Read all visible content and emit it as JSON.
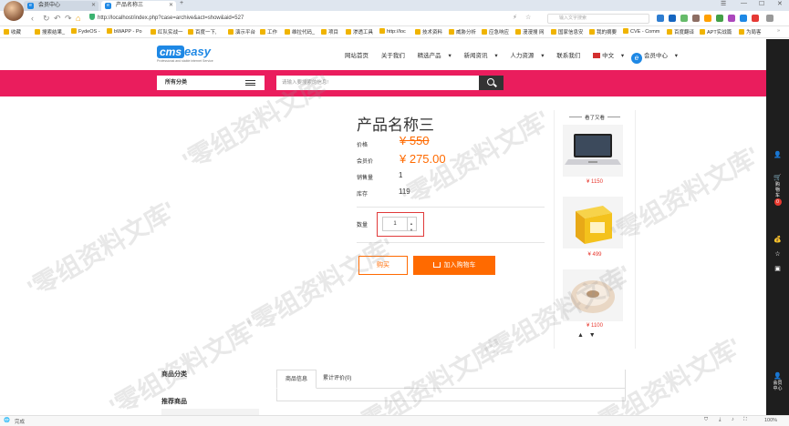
{
  "browser": {
    "tabs": [
      {
        "title": "会员中心",
        "active": false
      },
      {
        "title": "产品名称三",
        "active": true
      }
    ],
    "url": "http://localhost/index.php?case=archive&act=show&aid=527",
    "search_placeholder": "输入文字搜索",
    "bookmarks": [
      "收藏",
      "搜索结果_",
      "FydeOS -",
      "bWAPP - Po",
      "红队实战一",
      "百度一下,",
      "演示平台",
      "工作",
      "维拉代码_",
      "项目",
      "渗透工具",
      "http://loc",
      "技术资料",
      "威胁分析",
      "应急响应",
      "漫漫搜 网",
      "国家信息安",
      "我的摘要",
      "CVE - Comm",
      "百度翻译",
      "APT实战篇",
      "为局客"
    ],
    "status_left": "完成",
    "zoom": "100%"
  },
  "site": {
    "logo_cms": "cms",
    "logo_easy": "easy",
    "logo_tagline": "Professional and stable internet Service",
    "nav": [
      "网站首页",
      "关于我们",
      "精选产品",
      "新闻资讯",
      "人力资源",
      "联系我们"
    ],
    "nav_dropdown_markers": [
      "",
      "",
      "▾",
      "▾",
      "▾",
      ""
    ],
    "language": "中文",
    "member": "会员中心",
    "category_label": "所有分类",
    "search_placeholder": "请输入要搜索的信息!",
    "accent_color": "#ea1d5d"
  },
  "product": {
    "title": "产品名称三",
    "labels": {
      "price": "价格",
      "member_price": "会员价",
      "sales": "销售量",
      "stock": "库存",
      "qty": "数量"
    },
    "price": "¥ 550",
    "member_price": "¥ 275.00",
    "sales": "1",
    "stock": "119",
    "qty": "1",
    "buy_label": "购买",
    "cart_label": "加入购物车",
    "price_color": "#ff6a00"
  },
  "sidebar": {
    "title": "看了又看",
    "items": [
      {
        "price": "¥ 1150"
      },
      {
        "price": "¥ 499"
      },
      {
        "price": "¥ 1100"
      }
    ]
  },
  "bottom": {
    "category_title": "商品分类",
    "recommend_title": "推荐商品",
    "tabs": [
      "商品信息",
      "累计评价(0)"
    ]
  },
  "toolbar": {
    "cart_label": "购物车",
    "cart_count": "0",
    "feedback_label": "反馈",
    "member_label": "会员中心"
  },
  "watermark": "'零组资料文库'"
}
